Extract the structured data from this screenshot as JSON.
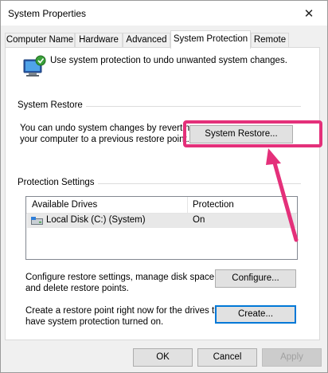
{
  "window": {
    "title": "System Properties"
  },
  "tabs": [
    {
      "label": "Computer Name"
    },
    {
      "label": "Hardware"
    },
    {
      "label": "Advanced"
    },
    {
      "label": "System Protection"
    },
    {
      "label": "Remote"
    }
  ],
  "active_tab": "System Protection",
  "intro": {
    "text": "Use system protection to undo unwanted system changes."
  },
  "system_restore": {
    "group_label": "System Restore",
    "description_line1": "You can undo system changes by reverting",
    "description_line2": "your computer to a previous restore point.",
    "button_label": "System Restore..."
  },
  "protection_settings": {
    "group_label": "Protection Settings",
    "columns": [
      "Available Drives",
      "Protection"
    ],
    "rows": [
      {
        "drive": "Local Disk (C:) (System)",
        "protection": "On"
      }
    ],
    "configure_text_line1": "Configure restore settings, manage disk space,",
    "configure_text_line2": "and delete restore points.",
    "configure_label": "Configure...",
    "create_text_line1": "Create a restore point right now for the drives that",
    "create_text_line2": "have system protection turned on.",
    "create_label": "Create..."
  },
  "footer": {
    "ok": "OK",
    "cancel": "Cancel",
    "apply": "Apply"
  },
  "annotation_color": "#e4307a"
}
